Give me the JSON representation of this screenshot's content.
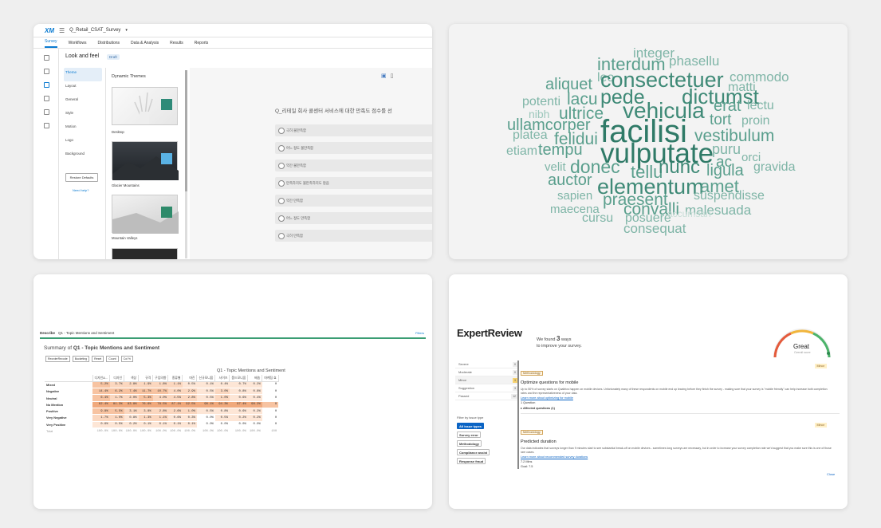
{
  "survey_editor": {
    "logo": "XM",
    "survey_name": "Q_Retail_CSAT_Survey",
    "tabs": [
      "Survey",
      "Workflows",
      "Distributions",
      "Data & Analysis",
      "Results",
      "Reports"
    ],
    "panel_title": "Look and feel",
    "badge": "Draft",
    "menu": [
      "Theme",
      "Layout",
      "General",
      "Style",
      "Motion",
      "Logo",
      "Background"
    ],
    "restore_button": "Restore Defaults",
    "help_link": "Need help?",
    "themes_title": "Dynamic Themes",
    "themes": [
      {
        "name": "Desktop",
        "swatch": "#2e8a78"
      },
      {
        "name": "Glacier Mountains",
        "swatch": "#5ab2e4"
      },
      {
        "name": "Mountain Valleys",
        "swatch": "#2e8a6a"
      },
      {
        "name": "",
        "swatch": "#c96f7a"
      }
    ],
    "question": "Q_리테일 회사 콜센터 서비스에 대한 만족도 점수를 선",
    "options": [
      "극히 불만족함",
      "어느 정도 불만족함",
      "약간 불만족함",
      "만족하지도 불만족하지도 않음",
      "약간 만족함",
      "어느 정도 만족함",
      "극히 만족함"
    ]
  },
  "word_cloud": [
    {
      "t": "integer",
      "s": 17
    },
    {
      "t": "phasellu",
      "s": 17
    },
    {
      "t": "interdum",
      "s": 22
    },
    {
      "t": "leo",
      "s": 16
    },
    {
      "t": "consectetuer",
      "s": 27
    },
    {
      "t": "commodo",
      "s": 17
    },
    {
      "t": "aliquet",
      "s": 20
    },
    {
      "t": "dictumst",
      "s": 26
    },
    {
      "t": "matti",
      "s": 16
    },
    {
      "t": "lacu",
      "s": 21
    },
    {
      "t": "pede",
      "s": 25
    },
    {
      "t": "erat",
      "s": 20
    },
    {
      "t": "potenti",
      "s": 16
    },
    {
      "t": "lectu",
      "s": 16
    },
    {
      "t": "vehicula",
      "s": 28
    },
    {
      "t": "nibh",
      "s": 14
    },
    {
      "t": "ultrice",
      "s": 21
    },
    {
      "t": "tort",
      "s": 19
    },
    {
      "t": "proin",
      "s": 16
    },
    {
      "t": "ullamcorper",
      "s": 20
    },
    {
      "t": "facilisi",
      "s": 40
    },
    {
      "t": "vestibulum",
      "s": 21
    },
    {
      "t": "platea",
      "s": 16
    },
    {
      "t": "felidui",
      "s": 21
    },
    {
      "t": "etiam",
      "s": 16
    },
    {
      "t": "tempu",
      "s": 20
    },
    {
      "t": "vulputate",
      "s": 35
    },
    {
      "t": "puru",
      "s": 18
    },
    {
      "t": "ac",
      "s": 19
    },
    {
      "t": "orci",
      "s": 15
    },
    {
      "t": "velit",
      "s": 15
    },
    {
      "t": "donec",
      "s": 23
    },
    {
      "t": "tellu",
      "s": 22
    },
    {
      "t": "nunc",
      "s": 24
    },
    {
      "t": "ligula",
      "s": 20
    },
    {
      "t": "gravida",
      "s": 16
    },
    {
      "t": "auctor",
      "s": 20
    },
    {
      "t": "elementum",
      "s": 27
    },
    {
      "t": "amet",
      "s": 22
    },
    {
      "t": "sapien",
      "s": 15
    },
    {
      "t": "praesent",
      "s": 21
    },
    {
      "t": "suspendisse",
      "s": 16
    },
    {
      "t": "maecena",
      "s": 15
    },
    {
      "t": "convalli",
      "s": 21
    },
    {
      "t": "malesuada",
      "s": 17
    },
    {
      "t": "cursu",
      "s": 16
    },
    {
      "t": "posuere",
      "s": 16
    },
    {
      "t": "accumsan",
      "s": 12
    },
    {
      "t": "consequat",
      "s": 17
    }
  ],
  "crosstab": {
    "describe_label": "Describe",
    "describe_item": "Q1 - Topic Mentions and Sentiment",
    "filters_label": "Filters",
    "summary_prefix": "Summary of",
    "summary_q": "Q1 - Topic Mentions and Sentiment",
    "buttons": [
      "ReorderRecode",
      "Bucketing",
      "Reset",
      "Count",
      "Col %"
    ],
    "table_title": "Q1 - Topic Mentions and Sentiment",
    "columns": [
      "디자인&...",
      "디자인",
      "색상",
      "규격",
      "구입의향",
      "종류별",
      "마진",
      "신규모니움",
      "사이즈",
      "품드모니움",
      "배송",
      "마케팅 효"
    ],
    "total_col": "Total",
    "rows": [
      {
        "label": "Mixed",
        "values": [
          "5.2%",
          "3.7%",
          "2.8%",
          "1.9%",
          "1.8%",
          "1.1%",
          "0.5%",
          "0.1%",
          "0.4%",
          "0.7%",
          "0.2%",
          "0"
        ]
      },
      {
        "label": "Negative",
        "values": [
          "14.4%",
          "6.2%",
          "7.4%",
          "11.7%",
          "10.7%",
          "4.0%",
          "2.9%",
          "0.5%",
          "3.0%",
          "0.8%",
          "0.8%",
          "0"
        ]
      },
      {
        "label": "Neutral",
        "values": [
          "6.4%",
          "1.7%",
          "2.0%",
          "5.3%",
          "4.0%",
          "4.5%",
          "2.8%",
          "0.5%",
          "1.0%",
          "0.6%",
          "0.4%",
          "0"
        ]
      },
      {
        "label": "No Mention",
        "values": [
          "62.4%",
          "81.3%",
          "83.8%",
          "76.6%",
          "78.5%",
          "87.1%",
          "92.5%",
          "98.1%",
          "94.3%",
          "97.4%",
          "98.2%",
          "9"
        ]
      },
      {
        "label": "Positive",
        "values": [
          "9.8%",
          "5.5%",
          "3.1%",
          "3.8%",
          "2.8%",
          "2.6%",
          "1.0%",
          "0.5%",
          "0.8%",
          "0.6%",
          "0.2%",
          "0"
        ]
      },
      {
        "label": "Very Negative",
        "values": [
          "1.7%",
          "1.0%",
          "0.8%",
          "1.3%",
          "1.1%",
          "0.6%",
          "0.3%",
          "0.0%",
          "0.5%",
          "0.2%",
          "0.2%",
          "0"
        ]
      },
      {
        "label": "Very Positive",
        "values": [
          "0.6%",
          "0.5%",
          "0.2%",
          "0.1%",
          "0.1%",
          "0.1%",
          "0.1%",
          "0.0%",
          "0.0%",
          "0.0%",
          "0.0%",
          "0"
        ]
      },
      {
        "label": "Total",
        "values": [
          "100.0%",
          "100.0%",
          "100.0%",
          "100.0%",
          "100.0%",
          "100.0%",
          "100.0%",
          "100.0%",
          "100.0%",
          "100.0%",
          "100.0%",
          "100"
        ]
      }
    ]
  },
  "expert_review": {
    "title": "ExpertReview",
    "found_pre": "We found",
    "found_num": "3",
    "found_post": "ways",
    "found_line2": "to improve your survey.",
    "score": "Great",
    "score_sub": "Overall score",
    "severity": [
      {
        "label": "Severe",
        "count": "0"
      },
      {
        "label": "Moderate",
        "count": "0"
      },
      {
        "label": "Minor",
        "count": "3"
      },
      {
        "label": "Suggestion",
        "count": "3"
      },
      {
        "label": "Passed",
        "count": "12"
      }
    ],
    "filter_label": "Filter by issue type",
    "filters": [
      "All issue types",
      "Survey error",
      "Methodology",
      "Compliance assist",
      "Response fraud"
    ],
    "issues": [
      {
        "tag": "Methodology",
        "level": "Minor",
        "title": "Optimize questions for mobile",
        "body": "Up to 50% of survey starts on Qualtrics happen on mobile devices. Unfortunately many of these respondents on mobile end up leaving before they finish the survey - making sure that your survey is \"mobile friendly\" can help increase both completion rates and the representativeness of your data.",
        "link": "Learn more about optimizing for mobile",
        "extra": "1 Question",
        "affected": "Affected questions (1)"
      },
      {
        "tag": "Methodology",
        "level": "Minor",
        "title": "Predicted duration",
        "body": "Our data indicates that surveys longer than 9 minutes start to see substantial break-off on mobile devices - sometimes long surveys are necessary, but in order to increase your survey completion rate we'd suggest that you make sure this is one of those rare cases.",
        "link": "Learn more about recommended survey durations",
        "extra": "7.2 Mins",
        "extra2": "Goal: 7.5"
      }
    ],
    "close": "Close"
  }
}
